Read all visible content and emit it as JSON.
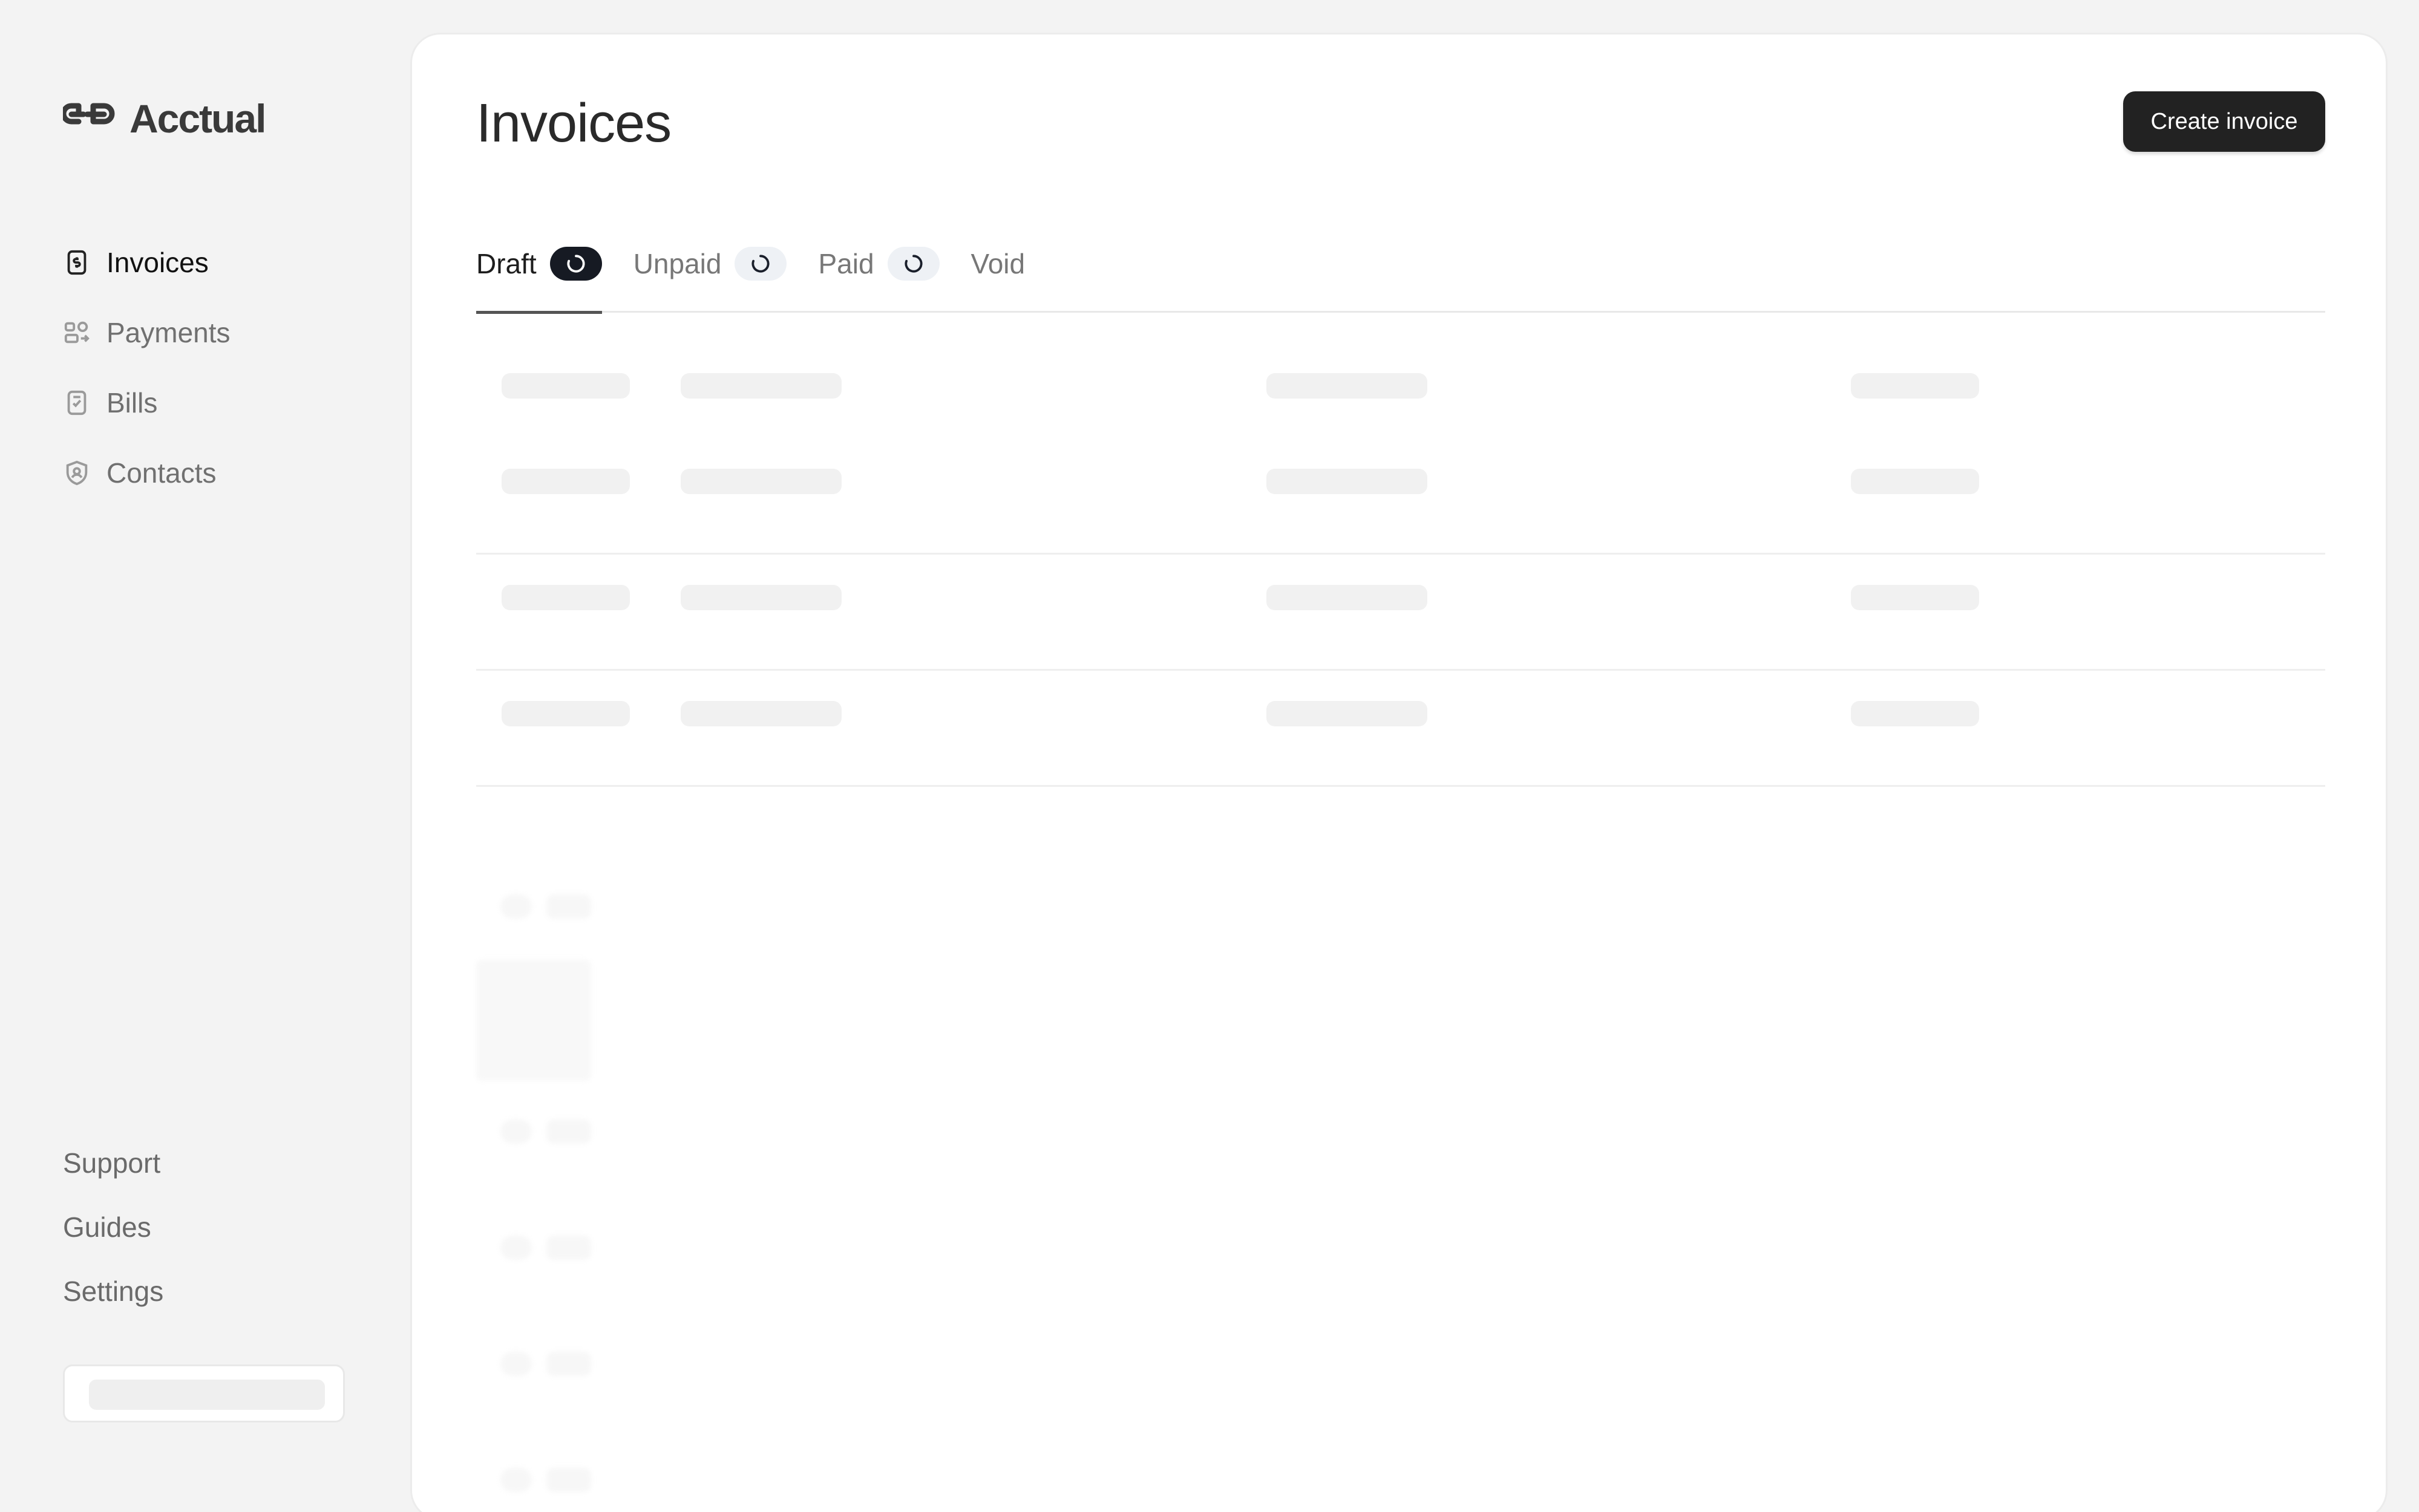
{
  "app": {
    "brand": "Acctual"
  },
  "sidebar": {
    "items": [
      {
        "label": "Invoices",
        "icon": "invoice-icon",
        "active": true
      },
      {
        "label": "Payments",
        "icon": "payments-icon",
        "active": false
      },
      {
        "label": "Bills",
        "icon": "bill-icon",
        "active": false
      },
      {
        "label": "Contacts",
        "icon": "contacts-icon",
        "active": false
      }
    ],
    "bottom_links": [
      "Support",
      "Guides",
      "Settings"
    ]
  },
  "main": {
    "title": "Invoices",
    "create_button": "Create invoice",
    "tabs": [
      {
        "label": "Draft",
        "active": true,
        "loading": true
      },
      {
        "label": "Unpaid",
        "active": false,
        "loading": true
      },
      {
        "label": "Paid",
        "active": false,
        "loading": true
      },
      {
        "label": "Void",
        "active": false,
        "loading": false
      }
    ]
  },
  "colors": {
    "background": "#f3f3f3",
    "panel": "#ffffff",
    "button": "#222222",
    "skeleton": "#f1f1f1"
  }
}
